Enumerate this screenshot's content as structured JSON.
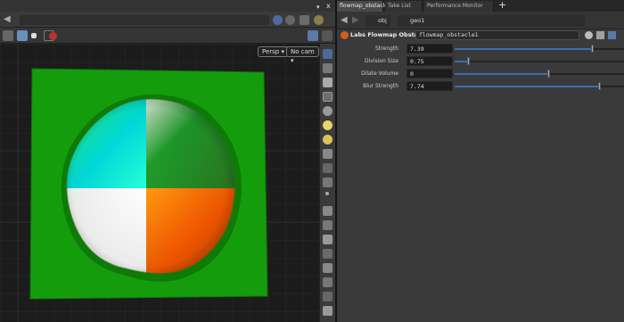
{
  "left_panel": {
    "path_toolbar": {
      "menu_label": "▾",
      "close_label": "x"
    },
    "viewport": {
      "view_menu": "Persp ▾",
      "camera_menu": "No cam ▾"
    }
  },
  "right_panel": {
    "tabs": [
      {
        "label": "flowmap_obstacle1",
        "active": true
      },
      {
        "label": "Take List",
        "active": false
      },
      {
        "label": "Performance Monitor",
        "active": false
      }
    ],
    "add_tab": "+",
    "breadcrumbs": [
      "obj",
      "geo1"
    ],
    "node": {
      "type_label": "Labs Flowmap Obstacle",
      "name": "flowmap_obstacle1"
    },
    "parameters": [
      {
        "label": "Strength",
        "value": "7.39",
        "fraction": 0.81
      },
      {
        "label": "Division Size",
        "value": "0.75",
        "fraction": 0.08
      },
      {
        "label": "Dilate Volume",
        "value": "0",
        "fraction": 0.55
      },
      {
        "label": "Blur Strength",
        "value": "7.74",
        "fraction": 0.85
      }
    ]
  },
  "colors": {
    "ground_green": "#149c0c",
    "quadrant_cyan": "#00e6e6",
    "quadrant_orange": "#ff5a00",
    "slider_blue": "#3a6fb0",
    "node_orange": "#d75a1c"
  }
}
